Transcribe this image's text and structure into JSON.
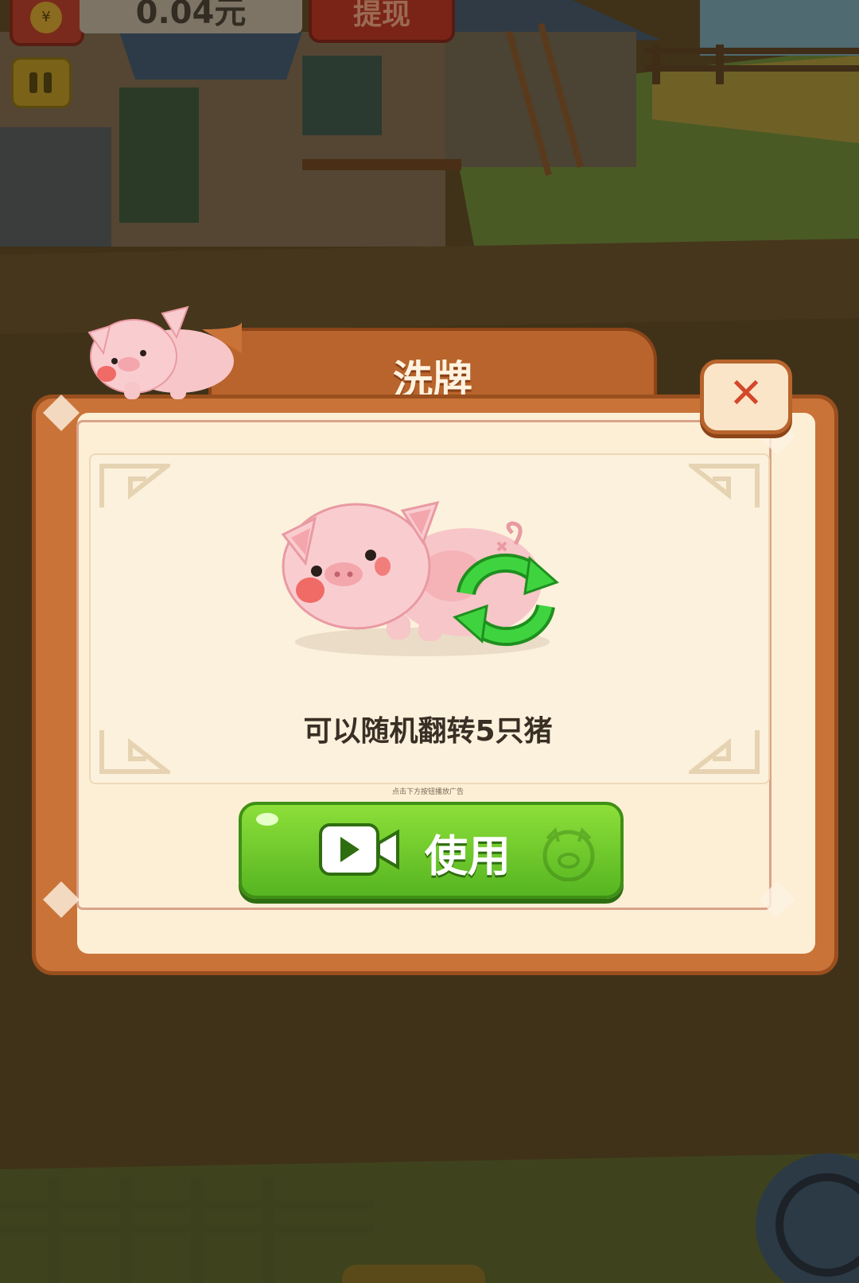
{
  "hud": {
    "balance": "0.04元",
    "withdraw_label": "提现",
    "coin_glyph": "¥"
  },
  "dialog": {
    "title": "洗牌",
    "description": "可以随机翻转5只猪",
    "ad_tip": "点击下方按钮播放广告",
    "use_label": "使用",
    "close_glyph": "✕"
  },
  "colors": {
    "panel": "#c97338",
    "panel_inner": "#fdefd5",
    "button_green": "#56b521",
    "close_x": "#d3472a"
  },
  "icons": [
    "pause-icon",
    "pig-icon",
    "refresh-icon",
    "video-icon",
    "close-icon"
  ]
}
